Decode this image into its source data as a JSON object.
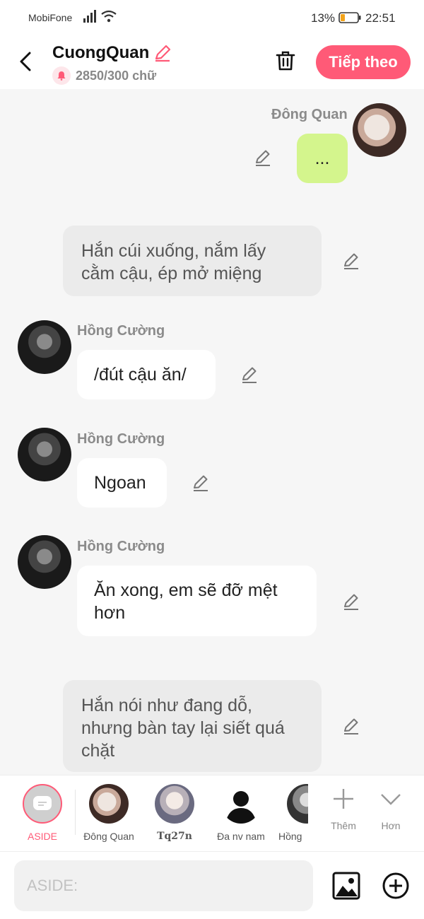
{
  "status_bar": {
    "carrier": "MobiFone",
    "battery": "13%",
    "time": "22:51"
  },
  "header": {
    "title": "CuongQuan",
    "word_count": "2850/300 chữ",
    "next_label": "Tiếp theo"
  },
  "messages": [
    {
      "type": "me",
      "name": "Đông Quan",
      "text": "..."
    },
    {
      "type": "aside",
      "text": "Hắn cúi xuống, nắm lấy cằm cậu, ép mở miệng"
    },
    {
      "type": "other",
      "name": "Hồng Cường",
      "text": "/đút cậu ăn/"
    },
    {
      "type": "other",
      "name": "Hồng Cường",
      "text": "Ngoan"
    },
    {
      "type": "other",
      "name": "Hồng Cường",
      "text": "Ăn xong, em sẽ đỡ mệt hơn"
    },
    {
      "type": "aside",
      "text": "Hắn nói như đang dỗ, nhưng bàn tay lại siết quá chặt"
    }
  ],
  "character_bar": {
    "items": [
      {
        "label": "ASIDE"
      },
      {
        "label": "Đông Quan"
      },
      {
        "label": "Tq27n"
      },
      {
        "label": "Đa nv nam"
      },
      {
        "label": "Hồng"
      }
    ],
    "add_label": "Thêm",
    "more_label": "Hơn"
  },
  "composer": {
    "placeholder": "ASIDE:"
  },
  "colors": {
    "accent": "#ff5a77",
    "my_bubble": "#d4f58d",
    "aside_bubble": "#ebebeb"
  }
}
